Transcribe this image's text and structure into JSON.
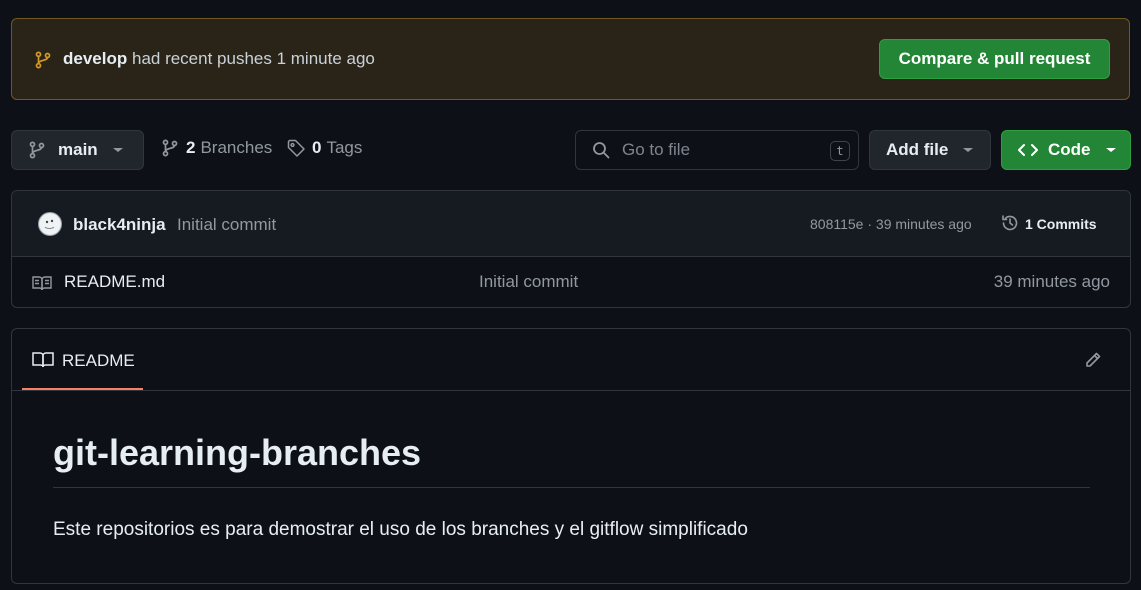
{
  "banner": {
    "branch": "develop",
    "message": "had recent pushes 1 minute ago",
    "compare_button": "Compare & pull request"
  },
  "toolbar": {
    "current_branch": "main",
    "branches_count": "2",
    "branches_label": "Branches",
    "tags_count": "0",
    "tags_label": "Tags",
    "search_placeholder": "Go to file",
    "search_shortcut": "t",
    "add_file_label": "Add file",
    "code_label": "Code"
  },
  "latest_commit": {
    "author": "black4ninja",
    "message": "Initial commit",
    "meta": "808115e · 39 minutes ago",
    "commits_label": "1 Commits"
  },
  "files": [
    {
      "name": "README.md",
      "commit_message": "Initial commit",
      "age": "39 minutes ago"
    }
  ],
  "readme": {
    "tab_label": "README",
    "title": "git-learning-branches",
    "body": "Este repositorios es para demostrar el uso de los branches y el gitflow simplificado"
  },
  "colors": {
    "background": "#0d1117",
    "banner_bg": "#2a2418",
    "banner_border": "#6e5a20",
    "primary_button": "#238636",
    "active_tab_underline": "#f78166",
    "branch_icon": "#d29922"
  }
}
